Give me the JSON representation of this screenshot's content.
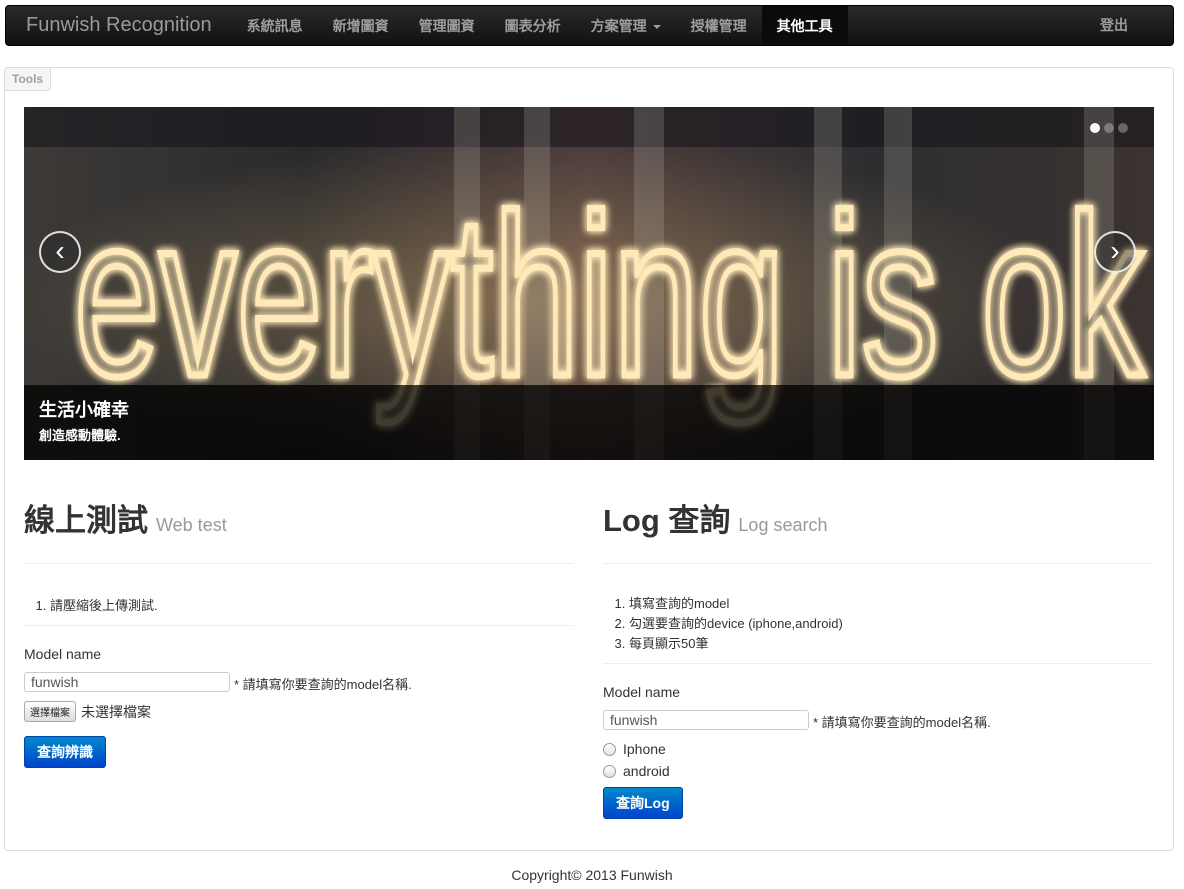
{
  "navbar": {
    "brand": "Funwish Recognition",
    "items": [
      {
        "label": "系統訊息"
      },
      {
        "label": "新增圖資"
      },
      {
        "label": "管理圖資"
      },
      {
        "label": "圖表分析"
      },
      {
        "label": "方案管理"
      },
      {
        "label": "授權管理"
      },
      {
        "label": "其他工具"
      }
    ],
    "logout": "登出"
  },
  "panel": {
    "label": "Tools"
  },
  "carousel": {
    "neon_text": "everything is ok",
    "prev": "‹",
    "next": "›",
    "caption_title": "生活小確幸",
    "caption_text": "創造感動體驗."
  },
  "web_test": {
    "title": "線上測試",
    "subtitle": "Web test",
    "steps": [
      "請壓縮後上傳測試."
    ],
    "model_label": "Model name",
    "model_value": "funwish",
    "hint": "* 請填寫你要查詢的model名稱.",
    "file_button": "選擇檔案",
    "file_status": "未選擇檔案",
    "submit": "查詢辨識"
  },
  "log_search": {
    "title": "Log 查詢",
    "subtitle": "Log search",
    "steps": [
      "填寫查詢的model",
      "勾選要查詢的device (iphone,android)",
      "每頁顯示50筆"
    ],
    "model_label": "Model name",
    "model_value": "funwish",
    "hint": "* 請填寫你要查詢的model名稱.",
    "options": [
      "Iphone",
      "android"
    ],
    "submit": "查詢Log"
  },
  "footer": {
    "copyright": "Copyright© 2013 Funwish"
  }
}
